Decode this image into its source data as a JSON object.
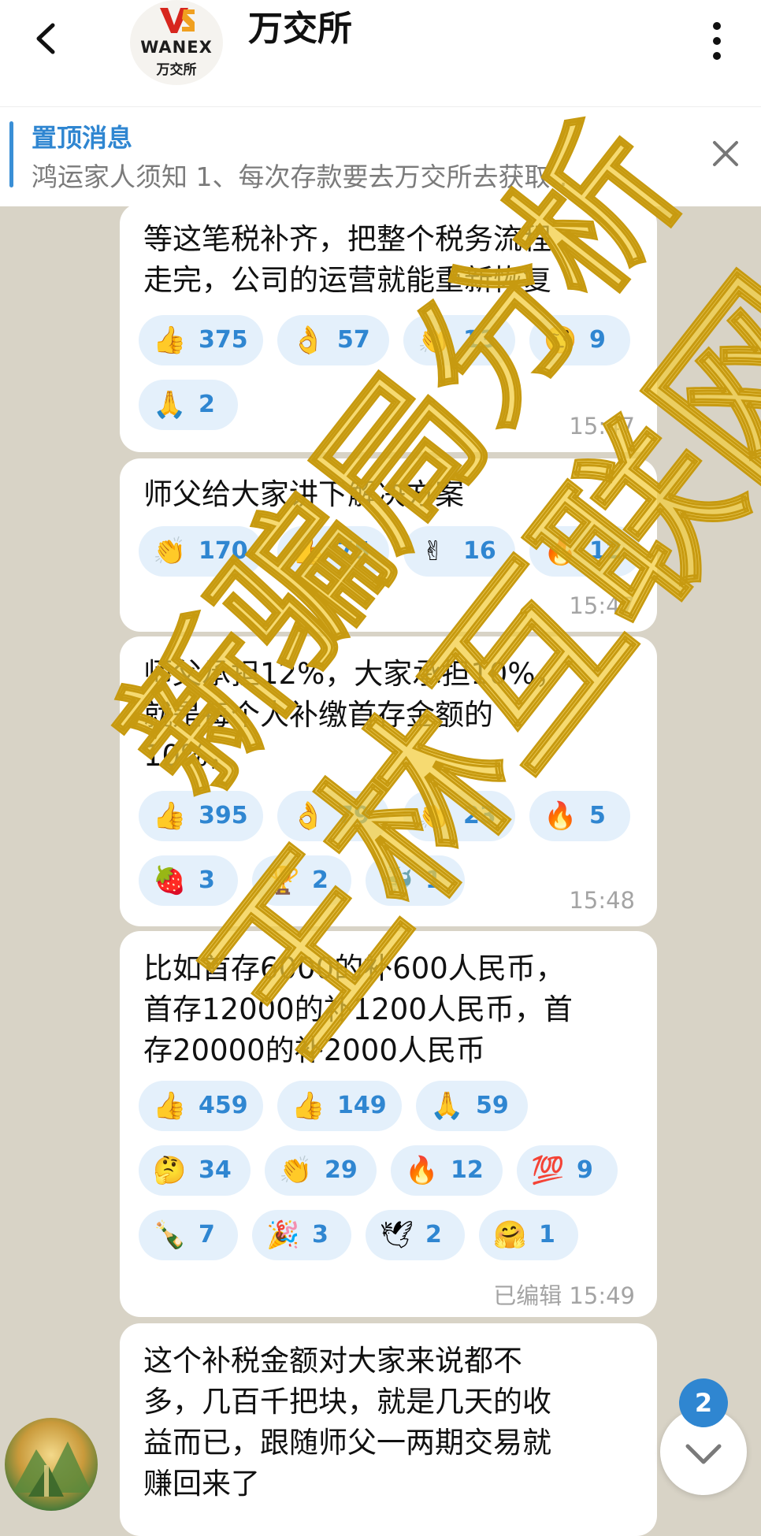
{
  "header": {
    "title": "万交所",
    "logo_brand": "WANEX",
    "logo_brand_cn": "万交所"
  },
  "pinned": {
    "label": "置顶消息",
    "text": "鸿运家人须知  1、每次存款要去万交所去获取…"
  },
  "messages": [
    {
      "lines": [
        "等这笔税补齐，把整个税务流程",
        "走完，公司的运营就能重新恢复"
      ],
      "reactions": [
        {
          "icon": "thumbs-up-icon",
          "glyph": "👍",
          "count": "375"
        },
        {
          "icon": "ok-hand-icon",
          "glyph": "👌",
          "count": "57"
        },
        {
          "icon": "clapping-hands-icon",
          "glyph": "👏",
          "count": "13"
        },
        {
          "icon": "raised-eyebrow-icon",
          "glyph": "🤨",
          "count": "9"
        },
        {
          "icon": "folded-hands-icon",
          "glyph": "🙏",
          "count": "2"
        }
      ],
      "time": "15:47"
    },
    {
      "lines": [
        "师父给大家讲下解决方案"
      ],
      "reactions": [
        {
          "icon": "clapping-hands-icon",
          "glyph": "👏",
          "count": "170"
        },
        {
          "icon": "thumbs-up-icon",
          "glyph": "👍",
          "count": "75"
        },
        {
          "icon": "victory-hand-icon",
          "glyph": "✌",
          "count": "16"
        },
        {
          "icon": "fire-icon",
          "glyph": "🔥",
          "count": "12"
        }
      ],
      "time": "15:47"
    },
    {
      "lines": [
        "师父承担12%，大家承担10%，",
        "就是每个人补缴首存金额的",
        "10%，"
      ],
      "reactions": [
        {
          "icon": "thumbs-up-icon",
          "glyph": "👍",
          "count": "395"
        },
        {
          "icon": "ok-hand-icon",
          "glyph": "👌",
          "count": "79"
        },
        {
          "icon": "clapping-hands-icon",
          "glyph": "👏",
          "count": "23"
        },
        {
          "icon": "fire-icon",
          "glyph": "🔥",
          "count": "5"
        },
        {
          "icon": "strawberry-icon",
          "glyph": "🍓",
          "count": "3"
        },
        {
          "icon": "trophy-icon",
          "glyph": "🏆",
          "count": "2"
        },
        {
          "icon": "whale-icon",
          "glyph": "🐳",
          "count": "1"
        }
      ],
      "time": "15:48"
    },
    {
      "lines": [
        "比如首存6000的补600人民币，",
        "首存12000的补1200人民币，首",
        "存20000的补2000人民币"
      ],
      "reactions": [
        {
          "icon": "thumbs-up-icon",
          "glyph": "👍",
          "count": "459"
        },
        {
          "icon": "thumbs-up-icon",
          "glyph": "👍",
          "count": "149"
        },
        {
          "icon": "folded-hands-icon",
          "glyph": "🙏",
          "count": "59"
        },
        {
          "icon": "thinking-face-icon",
          "glyph": "🤔",
          "count": "34"
        },
        {
          "icon": "clapping-hands-icon",
          "glyph": "👏",
          "count": "29"
        },
        {
          "icon": "fire-icon",
          "glyph": "🔥",
          "count": "12"
        },
        {
          "icon": "hundred-points-icon",
          "glyph": "💯",
          "count": "9"
        },
        {
          "icon": "champagne-icon",
          "glyph": "🍾",
          "count": "7"
        },
        {
          "icon": "party-popper-icon",
          "glyph": "🎉",
          "count": "3"
        },
        {
          "icon": "dove-icon",
          "glyph": "🕊",
          "count": "2"
        },
        {
          "icon": "hugging-face-icon",
          "glyph": "🤗",
          "count": "1"
        }
      ],
      "edited_label": "已编辑",
      "time": "15:49"
    },
    {
      "lines": [
        "这个补税金额对大家来说都不",
        "多，几百千把块，就是几天的收",
        "益而已，跟随师父一两期交易就",
        "赚回来了"
      ]
    }
  ],
  "watermark": {
    "text_lines": [
      "王林互联网",
      "新骗局分析"
    ]
  },
  "unread_badge": "2",
  "colors": {
    "accent": "#2f86d1",
    "reaction_bg": "#e4f0fb",
    "chat_bg": "#d8d3c6",
    "watermark": "#f2cc3a"
  }
}
